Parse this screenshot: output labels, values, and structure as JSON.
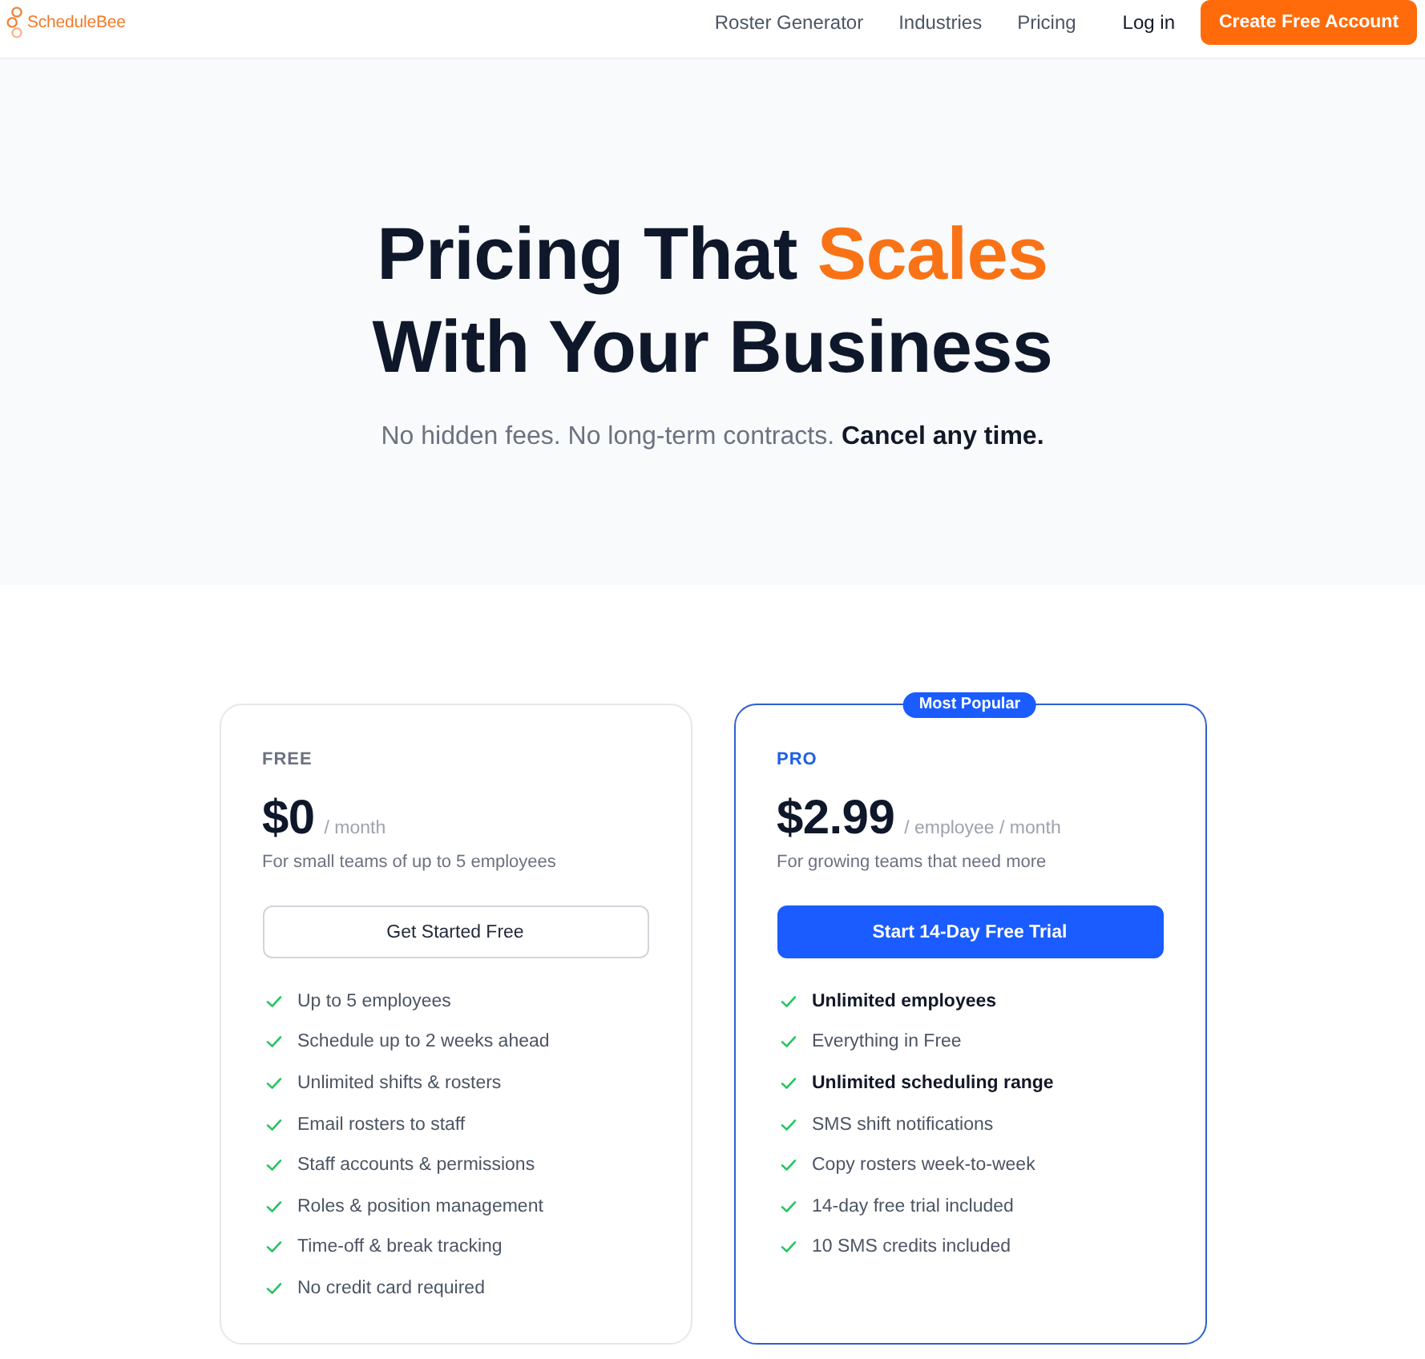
{
  "header": {
    "logo": "ScheduleBee",
    "nav": [
      {
        "label": "Roster Generator"
      },
      {
        "label": "Industries"
      },
      {
        "label": "Pricing"
      }
    ],
    "login": "Log in",
    "cta": "Create Free Account"
  },
  "hero": {
    "title_lines": [
      [
        {
          "text": "Pricing That ",
          "accent": false
        },
        {
          "text": "Scales",
          "accent": true
        }
      ],
      [
        {
          "text": "With Your Business",
          "accent": false
        }
      ]
    ],
    "subtitle": "No hidden fees. No long-term contracts. **Cancel any time.**"
  },
  "plans": [
    {
      "name": "FREE",
      "featured": false,
      "price": "$0",
      "period": "/ month",
      "description": "For small teams of up to 5 employees",
      "button": "Get Started Free",
      "features": [
        {
          "text": "Up to 5 employees",
          "bold": false
        },
        {
          "text": "Schedule up to 2 weeks ahead",
          "bold": false
        },
        {
          "text": "Unlimited shifts & rosters",
          "bold": false
        },
        {
          "text": "Email rosters to staff",
          "bold": false
        },
        {
          "text": "Staff accounts & permissions",
          "bold": false
        },
        {
          "text": "Roles & position management",
          "bold": false
        },
        {
          "text": "Time-off & break tracking",
          "bold": false
        },
        {
          "text": "No credit card required",
          "bold": false
        }
      ]
    },
    {
      "name": "PRO",
      "featured": true,
      "badge": "Most Popular",
      "price": "$2.99",
      "period": "/ employee / month",
      "description": "For growing teams that need more",
      "button": "Start 14-Day Free Trial",
      "features": [
        {
          "text": "Unlimited employees",
          "bold": true
        },
        {
          "text": "Everything in Free",
          "bold": false
        },
        {
          "text": "Unlimited scheduling range",
          "bold": true
        },
        {
          "text": "SMS shift notifications",
          "bold": false
        },
        {
          "text": "Copy rosters week-to-week",
          "bold": false
        },
        {
          "text": "14-day free trial included",
          "bold": false
        },
        {
          "text": "10 SMS credits included",
          "bold": false
        }
      ]
    }
  ]
}
